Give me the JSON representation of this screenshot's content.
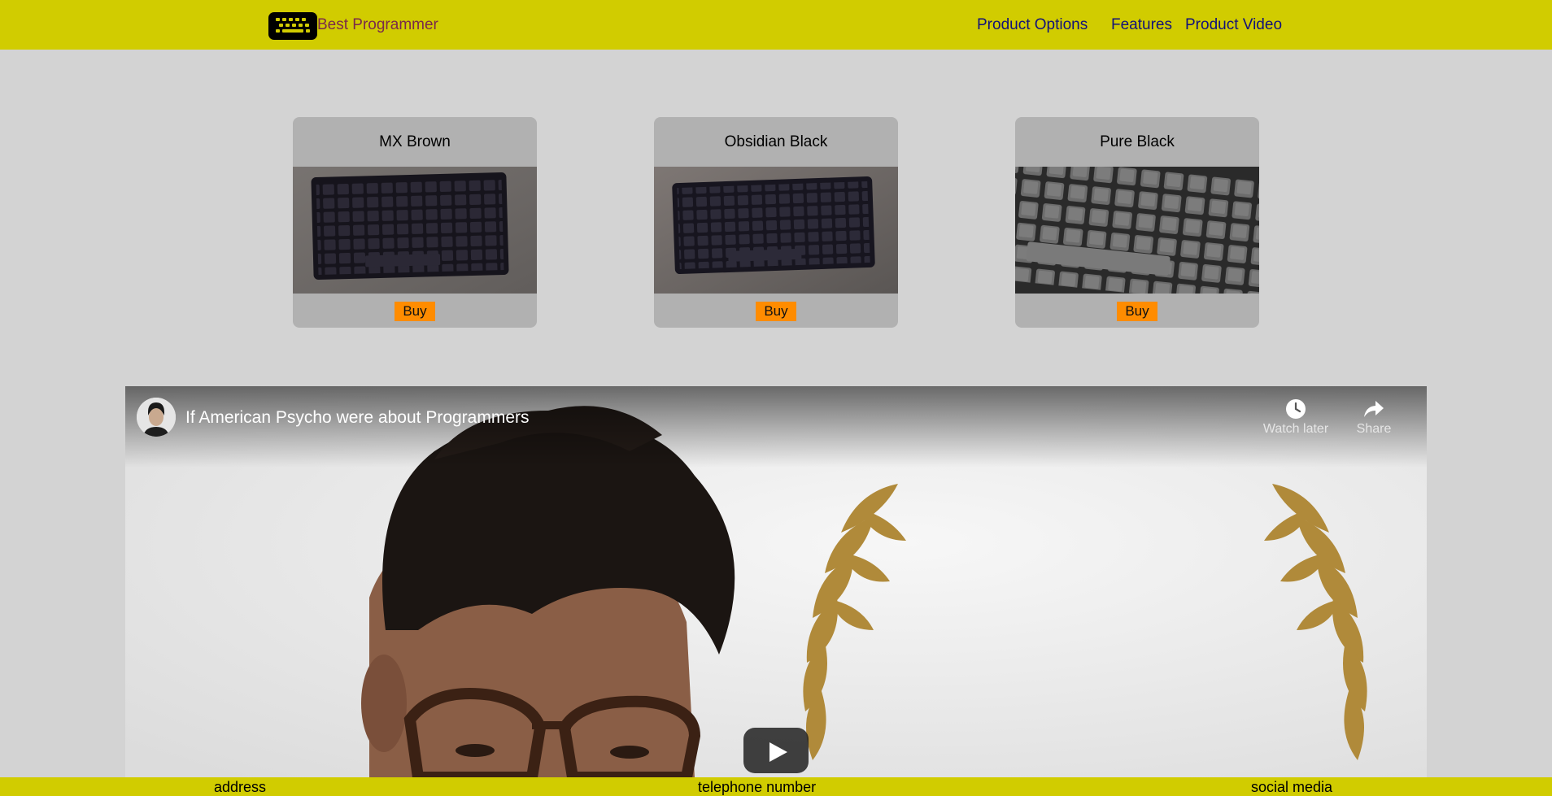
{
  "header": {
    "brand": "Best Programmer",
    "logo_icon": "keyboard-icon",
    "nav": [
      {
        "label": "Product Options"
      },
      {
        "label": "Features"
      },
      {
        "label": "Product Video"
      }
    ]
  },
  "products": [
    {
      "title": "MX Brown",
      "buy_label": "Buy"
    },
    {
      "title": "Obsidian Black",
      "buy_label": "Buy"
    },
    {
      "title": "Pure Black",
      "buy_label": "Buy"
    }
  ],
  "video": {
    "title": "If American Psycho were about Programmers",
    "watch_later_label": "Watch later",
    "share_label": "Share",
    "play_icon": "play-icon"
  },
  "footer": {
    "items": [
      "address",
      "telephone number",
      "social media"
    ]
  },
  "colors": {
    "header_bg": "#d1cc00",
    "page_bg": "#d3d3d3",
    "card_bg": "#b1b1b1",
    "buy_button": "#ff8c00",
    "nav_text": "#11117a",
    "brand_text": "#7a2a4a"
  }
}
